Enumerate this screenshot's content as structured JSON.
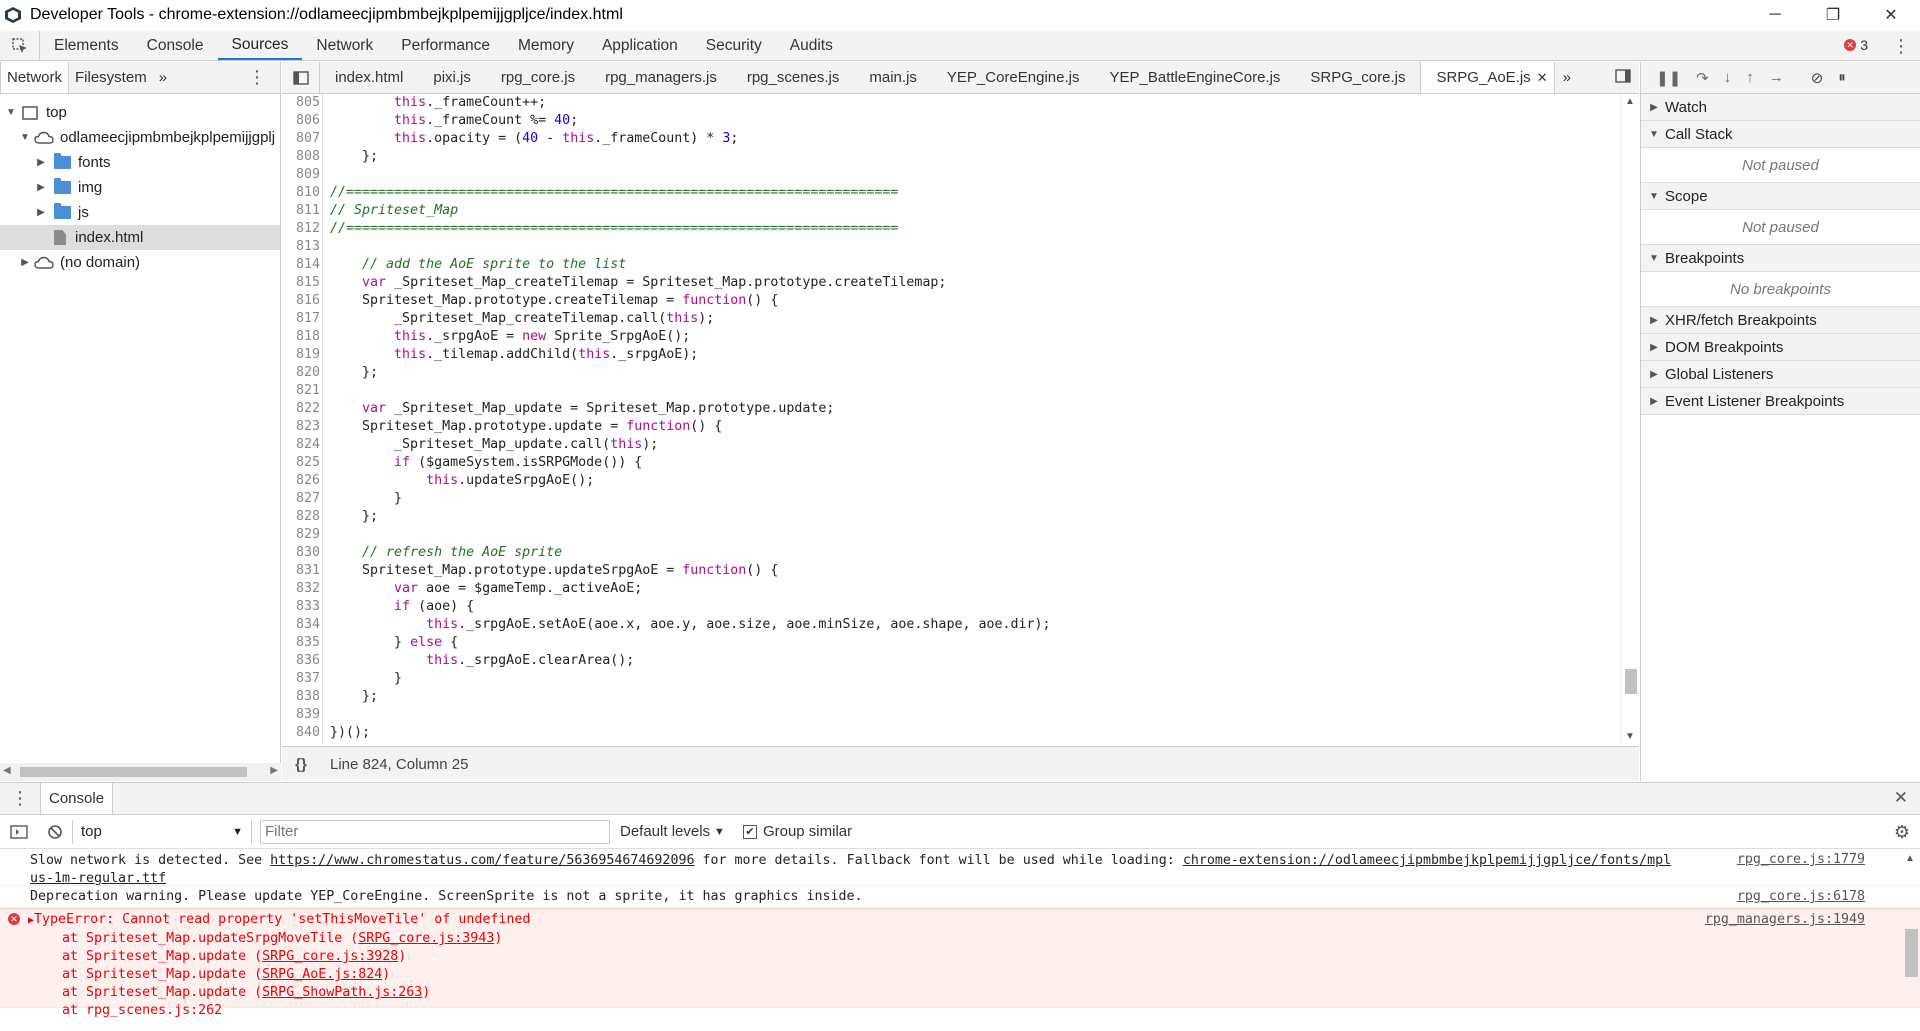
{
  "window": {
    "title": "Developer Tools - chrome-extension://odlameecjipmbmbejkplpemijjgpljce/index.html",
    "minimize": "─",
    "maximize": "❐",
    "close": "✕"
  },
  "main_tabs": [
    "Elements",
    "Console",
    "Sources",
    "Network",
    "Performance",
    "Memory",
    "Application",
    "Security",
    "Audits"
  ],
  "active_main_tab": "Sources",
  "error_count": "3",
  "navigator": {
    "tabs": [
      "Network",
      "Filesystem"
    ],
    "more": "»",
    "tree": {
      "top": "top",
      "origin": "odlameecjipmbmbejkplpemijjgplj",
      "folders": [
        "fonts",
        "img",
        "js"
      ],
      "file": "index.html",
      "no_domain": "(no domain)"
    }
  },
  "editor": {
    "file_tabs": [
      "index.html",
      "pixi.js",
      "rpg_core.js",
      "rpg_managers.js",
      "rpg_scenes.js",
      "main.js",
      "YEP_CoreEngine.js",
      "YEP_BattleEngineCore.js",
      "SRPG_core.js",
      "SRPG_AoE.js"
    ],
    "active_file": "SRPG_AoE.js",
    "status": "Line 824, Column 25",
    "format_icon": "{}",
    "lines": [
      {
        "n": "805",
        "t": "        this._frameCount++;"
      },
      {
        "n": "806",
        "t": "        this._frameCount %= 40;"
      },
      {
        "n": "807",
        "t": "        this.opacity = (40 - this._frameCount) * 3;"
      },
      {
        "n": "808",
        "t": "    };"
      },
      {
        "n": "809",
        "t": ""
      },
      {
        "n": "810",
        "t": "//====================================================================="
      },
      {
        "n": "811",
        "t": "// Spriteset_Map"
      },
      {
        "n": "812",
        "t": "//====================================================================="
      },
      {
        "n": "813",
        "t": ""
      },
      {
        "n": "814",
        "t": "    // add the AoE sprite to the list"
      },
      {
        "n": "815",
        "t": "    var _Spriteset_Map_createTilemap = Spriteset_Map.prototype.createTilemap;"
      },
      {
        "n": "816",
        "t": "    Spriteset_Map.prototype.createTilemap = function() {"
      },
      {
        "n": "817",
        "t": "        _Spriteset_Map_createTilemap.call(this);"
      },
      {
        "n": "818",
        "t": "        this._srpgAoE = new Sprite_SrpgAoE();"
      },
      {
        "n": "819",
        "t": "        this._tilemap.addChild(this._srpgAoE);"
      },
      {
        "n": "820",
        "t": "    };"
      },
      {
        "n": "821",
        "t": ""
      },
      {
        "n": "822",
        "t": "    var _Spriteset_Map_update = Spriteset_Map.prototype.update;"
      },
      {
        "n": "823",
        "t": "    Spriteset_Map.prototype.update = function() {"
      },
      {
        "n": "824",
        "t": "        _Spriteset_Map_update.call(this);"
      },
      {
        "n": "825",
        "t": "        if ($gameSystem.isSRPGMode()) {"
      },
      {
        "n": "826",
        "t": "            this.updateSrpgAoE();"
      },
      {
        "n": "827",
        "t": "        }"
      },
      {
        "n": "828",
        "t": "    };"
      },
      {
        "n": "829",
        "t": ""
      },
      {
        "n": "830",
        "t": "    // refresh the AoE sprite"
      },
      {
        "n": "831",
        "t": "    Spriteset_Map.prototype.updateSrpgAoE = function() {"
      },
      {
        "n": "832",
        "t": "        var aoe = $gameTemp._activeAoE;"
      },
      {
        "n": "833",
        "t": "        if (aoe) {"
      },
      {
        "n": "834",
        "t": "            this._srpgAoE.setAoE(aoe.x, aoe.y, aoe.size, aoe.minSize, aoe.shape, aoe.dir);"
      },
      {
        "n": "835",
        "t": "        } else {"
      },
      {
        "n": "836",
        "t": "            this._srpgAoE.clearArea();"
      },
      {
        "n": "837",
        "t": "        }"
      },
      {
        "n": "838",
        "t": "    };"
      },
      {
        "n": "839",
        "t": ""
      },
      {
        "n": "840",
        "t": "})();"
      }
    ]
  },
  "debugger": {
    "sections": [
      {
        "title": "Watch",
        "body": ""
      },
      {
        "title": "Call Stack",
        "body": "Not paused"
      },
      {
        "title": "Scope",
        "body": "Not paused"
      },
      {
        "title": "Breakpoints",
        "body": "No breakpoints"
      },
      {
        "title": "XHR/fetch Breakpoints",
        "body": ""
      },
      {
        "title": "DOM Breakpoints",
        "body": ""
      },
      {
        "title": "Global Listeners",
        "body": ""
      },
      {
        "title": "Event Listener Breakpoints",
        "body": ""
      }
    ]
  },
  "console": {
    "tab": "Console",
    "context": "top",
    "filter_placeholder": "Filter",
    "levels": "Default levels",
    "group_similar": "Group similar",
    "messages": [
      {
        "type": "info",
        "line1a": "Slow network is detected. See ",
        "link1": "https://www.chromestatus.com/feature/5636954674692096",
        "line1b": " for more details. Fallback font will be used while loading: ",
        "link2": "chrome-extension://odlameecjipmbmbejkplpemijjgpljce/fonts/mpl",
        "line2": "us-1m-regular.ttf",
        "src": "rpg_core.js:1779"
      },
      {
        "type": "info",
        "text": "Deprecation warning. Please update YEP_CoreEngine. ScreenSprite is not a sprite, it has graphics inside.",
        "src": "rpg_core.js:6178"
      },
      {
        "type": "error",
        "text": "TypeError: Cannot read property 'setThisMoveTile' of undefined",
        "src": "rpg_managers.js:1949",
        "stack": [
          {
            "pre": "    at Spriteset_Map.updateSrpgMoveTile (",
            "loc": "SRPG_core.js:3943",
            "post": ")"
          },
          {
            "pre": "    at Spriteset_Map.update (",
            "loc": "SRPG_core.js:3928",
            "post": ")"
          },
          {
            "pre": "    at Spriteset_Map.update (",
            "loc": "SRPG_AoE.js:824",
            "post": ")"
          },
          {
            "pre": "    at Spriteset_Map.update (",
            "loc": "SRPG_ShowPath.js:263",
            "post": ")"
          },
          {
            "pre": "    at rpg_scenes.js:262",
            "loc": "",
            "post": ""
          }
        ]
      }
    ]
  },
  "colors": {
    "accent": "#1a73e8",
    "error": "#e03c3c",
    "comment": "#236e25",
    "keyword": "#aa0d91"
  }
}
